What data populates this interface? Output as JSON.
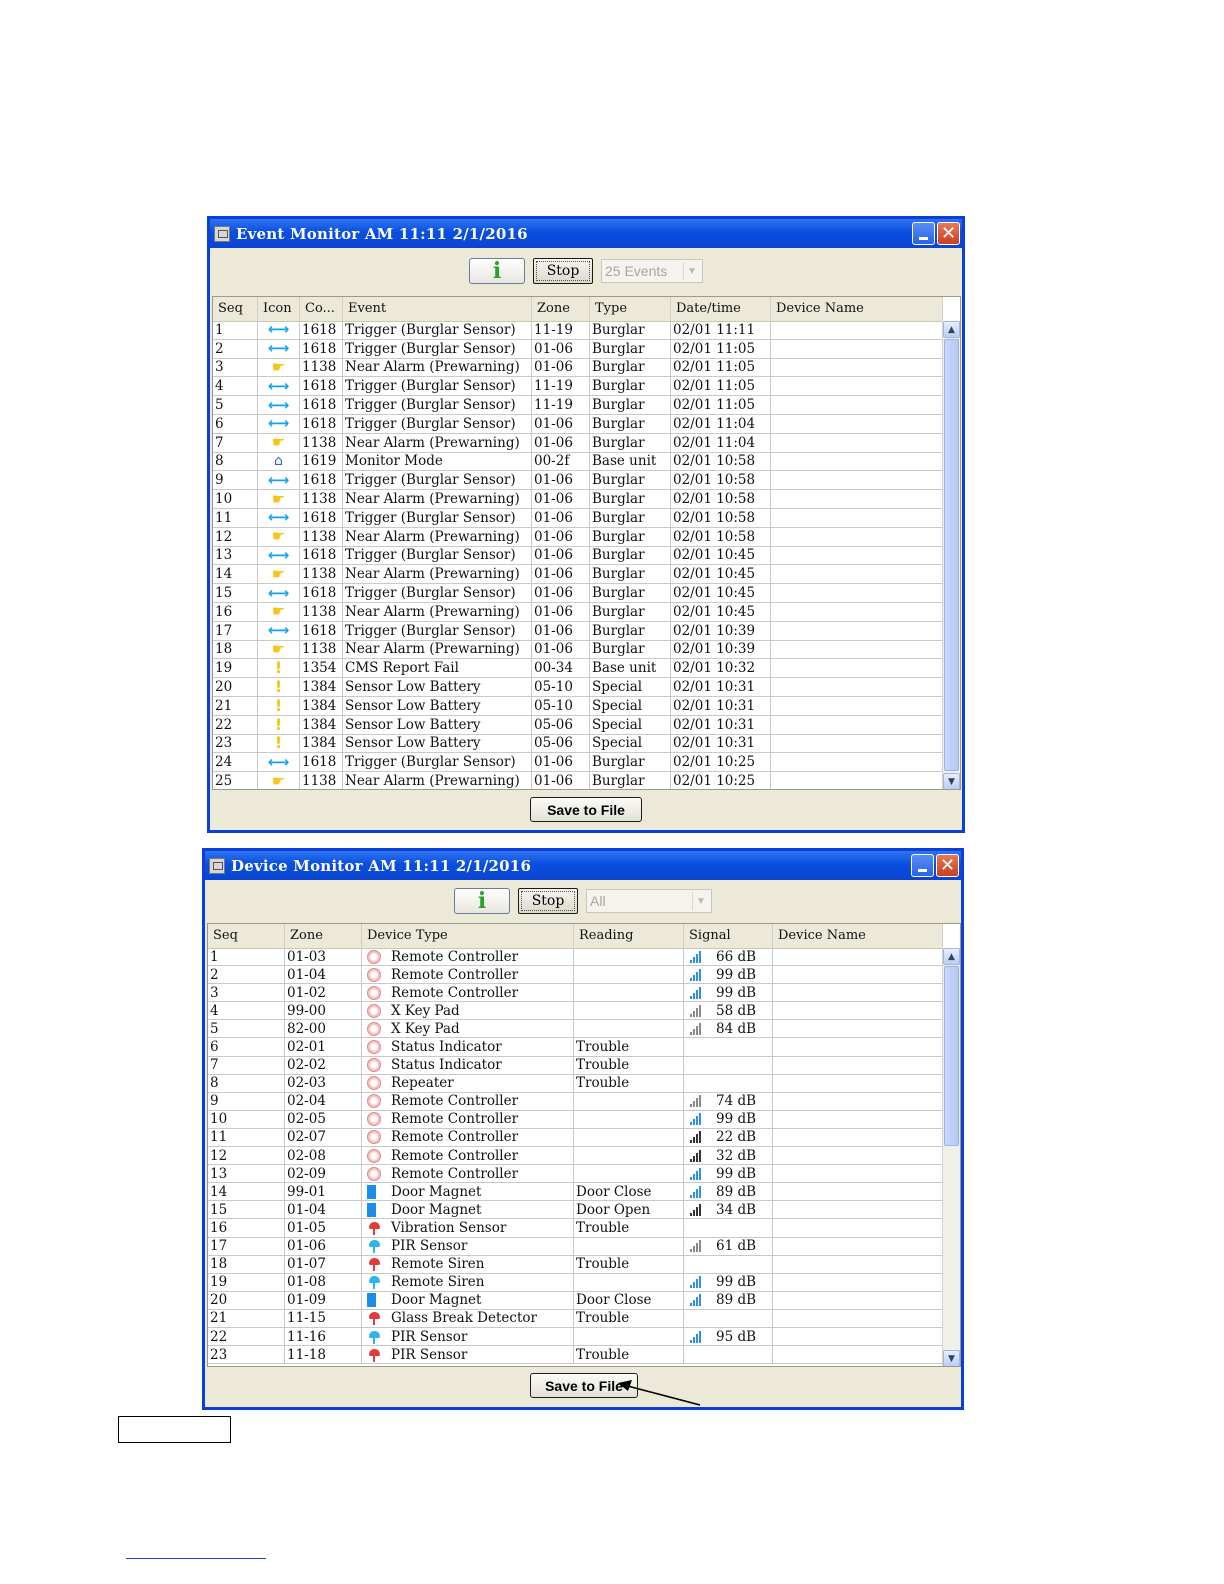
{
  "event_monitor": {
    "title": "Event Monitor  AM 11:11  2/1/2016",
    "info_icon": "i",
    "stop_label": "Stop",
    "events_select": "25 Events",
    "columns": [
      "Seq",
      "Icon",
      "Co...",
      "Event",
      "Zone",
      "Type",
      "Date/time",
      "Device Name"
    ],
    "rows": [
      {
        "seq": "1",
        "icon": "arrow",
        "code": "1618",
        "event": "Trigger (Burglar Sensor)",
        "zone": "11-19",
        "type": "Burglar",
        "datetime": "02/01 11:11",
        "device": ""
      },
      {
        "seq": "2",
        "icon": "arrow",
        "code": "1618",
        "event": "Trigger (Burglar Sensor)",
        "zone": "01-06",
        "type": "Burglar",
        "datetime": "02/01 11:05",
        "device": ""
      },
      {
        "seq": "3",
        "icon": "hand",
        "code": "1138",
        "event": "Near Alarm (Prewarning)",
        "zone": "01-06",
        "type": "Burglar",
        "datetime": "02/01 11:05",
        "device": ""
      },
      {
        "seq": "4",
        "icon": "arrow",
        "code": "1618",
        "event": "Trigger (Burglar Sensor)",
        "zone": "11-19",
        "type": "Burglar",
        "datetime": "02/01 11:05",
        "device": ""
      },
      {
        "seq": "5",
        "icon": "arrow",
        "code": "1618",
        "event": "Trigger (Burglar Sensor)",
        "zone": "11-19",
        "type": "Burglar",
        "datetime": "02/01 11:05",
        "device": ""
      },
      {
        "seq": "6",
        "icon": "arrow",
        "code": "1618",
        "event": "Trigger (Burglar Sensor)",
        "zone": "01-06",
        "type": "Burglar",
        "datetime": "02/01 11:04",
        "device": ""
      },
      {
        "seq": "7",
        "icon": "hand",
        "code": "1138",
        "event": "Near Alarm (Prewarning)",
        "zone": "01-06",
        "type": "Burglar",
        "datetime": "02/01 11:04",
        "device": ""
      },
      {
        "seq": "8",
        "icon": "home",
        "code": "1619",
        "event": "Monitor Mode",
        "zone": "00-2f",
        "type": "Base unit",
        "datetime": "02/01 10:58",
        "device": ""
      },
      {
        "seq": "9",
        "icon": "arrow",
        "code": "1618",
        "event": "Trigger (Burglar Sensor)",
        "zone": "01-06",
        "type": "Burglar",
        "datetime": "02/01 10:58",
        "device": ""
      },
      {
        "seq": "10",
        "icon": "hand",
        "code": "1138",
        "event": "Near Alarm (Prewarning)",
        "zone": "01-06",
        "type": "Burglar",
        "datetime": "02/01 10:58",
        "device": ""
      },
      {
        "seq": "11",
        "icon": "arrow",
        "code": "1618",
        "event": "Trigger (Burglar Sensor)",
        "zone": "01-06",
        "type": "Burglar",
        "datetime": "02/01 10:58",
        "device": ""
      },
      {
        "seq": "12",
        "icon": "hand",
        "code": "1138",
        "event": "Near Alarm (Prewarning)",
        "zone": "01-06",
        "type": "Burglar",
        "datetime": "02/01 10:58",
        "device": ""
      },
      {
        "seq": "13",
        "icon": "arrow",
        "code": "1618",
        "event": "Trigger (Burglar Sensor)",
        "zone": "01-06",
        "type": "Burglar",
        "datetime": "02/01 10:45",
        "device": ""
      },
      {
        "seq": "14",
        "icon": "hand",
        "code": "1138",
        "event": "Near Alarm (Prewarning)",
        "zone": "01-06",
        "type": "Burglar",
        "datetime": "02/01 10:45",
        "device": ""
      },
      {
        "seq": "15",
        "icon": "arrow",
        "code": "1618",
        "event": "Trigger (Burglar Sensor)",
        "zone": "01-06",
        "type": "Burglar",
        "datetime": "02/01 10:45",
        "device": ""
      },
      {
        "seq": "16",
        "icon": "hand",
        "code": "1138",
        "event": "Near Alarm (Prewarning)",
        "zone": "01-06",
        "type": "Burglar",
        "datetime": "02/01 10:45",
        "device": ""
      },
      {
        "seq": "17",
        "icon": "arrow",
        "code": "1618",
        "event": "Trigger (Burglar Sensor)",
        "zone": "01-06",
        "type": "Burglar",
        "datetime": "02/01 10:39",
        "device": ""
      },
      {
        "seq": "18",
        "icon": "hand",
        "code": "1138",
        "event": "Near Alarm (Prewarning)",
        "zone": "01-06",
        "type": "Burglar",
        "datetime": "02/01 10:39",
        "device": ""
      },
      {
        "seq": "19",
        "icon": "bang",
        "code": "1354",
        "event": "CMS Report Fail",
        "zone": "00-34",
        "type": "Base unit",
        "datetime": "02/01 10:32",
        "device": ""
      },
      {
        "seq": "20",
        "icon": "bang",
        "code": "1384",
        "event": "Sensor Low Battery",
        "zone": "05-10",
        "type": "Special",
        "datetime": "02/01 10:31",
        "device": ""
      },
      {
        "seq": "21",
        "icon": "bang",
        "code": "1384",
        "event": "Sensor Low Battery",
        "zone": "05-10",
        "type": "Special",
        "datetime": "02/01 10:31",
        "device": ""
      },
      {
        "seq": "22",
        "icon": "bang",
        "code": "1384",
        "event": "Sensor Low Battery",
        "zone": "05-06",
        "type": "Special",
        "datetime": "02/01 10:31",
        "device": ""
      },
      {
        "seq": "23",
        "icon": "bang",
        "code": "1384",
        "event": "Sensor Low Battery",
        "zone": "05-06",
        "type": "Special",
        "datetime": "02/01 10:31",
        "device": ""
      },
      {
        "seq": "24",
        "icon": "arrow",
        "code": "1618",
        "event": "Trigger (Burglar Sensor)",
        "zone": "01-06",
        "type": "Burglar",
        "datetime": "02/01 10:25",
        "device": ""
      },
      {
        "seq": "25",
        "icon": "hand",
        "code": "1138",
        "event": "Near Alarm (Prewarning)",
        "zone": "01-06",
        "type": "Burglar",
        "datetime": "02/01 10:25",
        "device": ""
      }
    ],
    "save_label": "Save to File"
  },
  "device_monitor": {
    "title": "Device Monitor  AM 11:11  2/1/2016",
    "info_icon": "i",
    "stop_label": "Stop",
    "filter_select": "All",
    "columns": [
      "Seq",
      "Zone",
      "Device Type",
      "Reading",
      "Signal",
      "Device Name"
    ],
    "rows": [
      {
        "seq": "1",
        "zone": "01-03",
        "icon": "remote",
        "device_type": "Remote Controller",
        "reading": "",
        "signal": "66 dB",
        "sig": "blue",
        "device": ""
      },
      {
        "seq": "2",
        "zone": "01-04",
        "icon": "remote",
        "device_type": "Remote Controller",
        "reading": "",
        "signal": "99 dB",
        "sig": "blue",
        "device": ""
      },
      {
        "seq": "3",
        "zone": "01-02",
        "icon": "remote",
        "device_type": "Remote Controller",
        "reading": "",
        "signal": "99 dB",
        "sig": "blue",
        "device": ""
      },
      {
        "seq": "4",
        "zone": "99-00",
        "icon": "remote",
        "device_type": "X Key Pad",
        "reading": "",
        "signal": "58 dB",
        "sig": "grey",
        "device": ""
      },
      {
        "seq": "5",
        "zone": "82-00",
        "icon": "remote",
        "device_type": "X Key Pad",
        "reading": "",
        "signal": "84 dB",
        "sig": "grey",
        "device": ""
      },
      {
        "seq": "6",
        "zone": "02-01",
        "icon": "remote",
        "device_type": "Status Indicator",
        "reading": "Trouble",
        "signal": "",
        "sig": "",
        "device": ""
      },
      {
        "seq": "7",
        "zone": "02-02",
        "icon": "remote",
        "device_type": "Status Indicator",
        "reading": "Trouble",
        "signal": "",
        "sig": "",
        "device": ""
      },
      {
        "seq": "8",
        "zone": "02-03",
        "icon": "remote",
        "device_type": "Repeater",
        "reading": "Trouble",
        "signal": "",
        "sig": "",
        "device": ""
      },
      {
        "seq": "9",
        "zone": "02-04",
        "icon": "remote",
        "device_type": "Remote Controller",
        "reading": "",
        "signal": "74 dB",
        "sig": "grey",
        "device": ""
      },
      {
        "seq": "10",
        "zone": "02-05",
        "icon": "remote",
        "device_type": "Remote Controller",
        "reading": "",
        "signal": "99 dB",
        "sig": "blue",
        "device": ""
      },
      {
        "seq": "11",
        "zone": "02-07",
        "icon": "remote",
        "device_type": "Remote Controller",
        "reading": "",
        "signal": "22 dB",
        "sig": "dark",
        "device": ""
      },
      {
        "seq": "12",
        "zone": "02-08",
        "icon": "remote",
        "device_type": "Remote Controller",
        "reading": "",
        "signal": "32 dB",
        "sig": "dark",
        "device": ""
      },
      {
        "seq": "13",
        "zone": "02-09",
        "icon": "remote",
        "device_type": "Remote Controller",
        "reading": "",
        "signal": "99 dB",
        "sig": "blue",
        "device": ""
      },
      {
        "seq": "14",
        "zone": "99-01",
        "icon": "magnet",
        "device_type": "Door Magnet",
        "reading": "Door Close",
        "signal": "89 dB",
        "sig": "blue",
        "device": ""
      },
      {
        "seq": "15",
        "zone": "01-04",
        "icon": "magnet",
        "device_type": "Door Magnet",
        "reading": "Door Open",
        "signal": "34 dB",
        "sig": "dark",
        "device": ""
      },
      {
        "seq": "16",
        "zone": "01-05",
        "icon": "sensor-red",
        "device_type": "Vibration Sensor",
        "reading": "Trouble",
        "signal": "",
        "sig": "",
        "device": ""
      },
      {
        "seq": "17",
        "zone": "01-06",
        "icon": "sensor-blue",
        "device_type": "PIR Sensor",
        "reading": "",
        "signal": "61 dB",
        "sig": "grey",
        "device": ""
      },
      {
        "seq": "18",
        "zone": "01-07",
        "icon": "sensor-red",
        "device_type": "Remote Siren",
        "reading": "Trouble",
        "signal": "",
        "sig": "",
        "device": ""
      },
      {
        "seq": "19",
        "zone": "01-08",
        "icon": "sensor-blue",
        "device_type": "Remote Siren",
        "reading": "",
        "signal": "99 dB",
        "sig": "blue",
        "device": ""
      },
      {
        "seq": "20",
        "zone": "01-09",
        "icon": "magnet",
        "device_type": "Door Magnet",
        "reading": "Door Close",
        "signal": "89 dB",
        "sig": "blue",
        "device": ""
      },
      {
        "seq": "21",
        "zone": "11-15",
        "icon": "sensor-red",
        "device_type": "Glass Break Detector",
        "reading": "Trouble",
        "signal": "",
        "sig": "",
        "device": ""
      },
      {
        "seq": "22",
        "zone": "11-16",
        "icon": "sensor-blue",
        "device_type": "PIR Sensor",
        "reading": "",
        "signal": "95 dB",
        "sig": "blue",
        "device": ""
      },
      {
        "seq": "23",
        "zone": "11-18",
        "icon": "sensor-red",
        "device_type": "PIR Sensor",
        "reading": "Trouble",
        "signal": "",
        "sig": "",
        "device": ""
      }
    ],
    "save_label": "Save to File"
  },
  "colors": {
    "title_bar": "#0a4fe0",
    "window_bg": "#ece9d8",
    "arrow_icon": "#19a1f0",
    "warning_icon": "#f5c518"
  }
}
